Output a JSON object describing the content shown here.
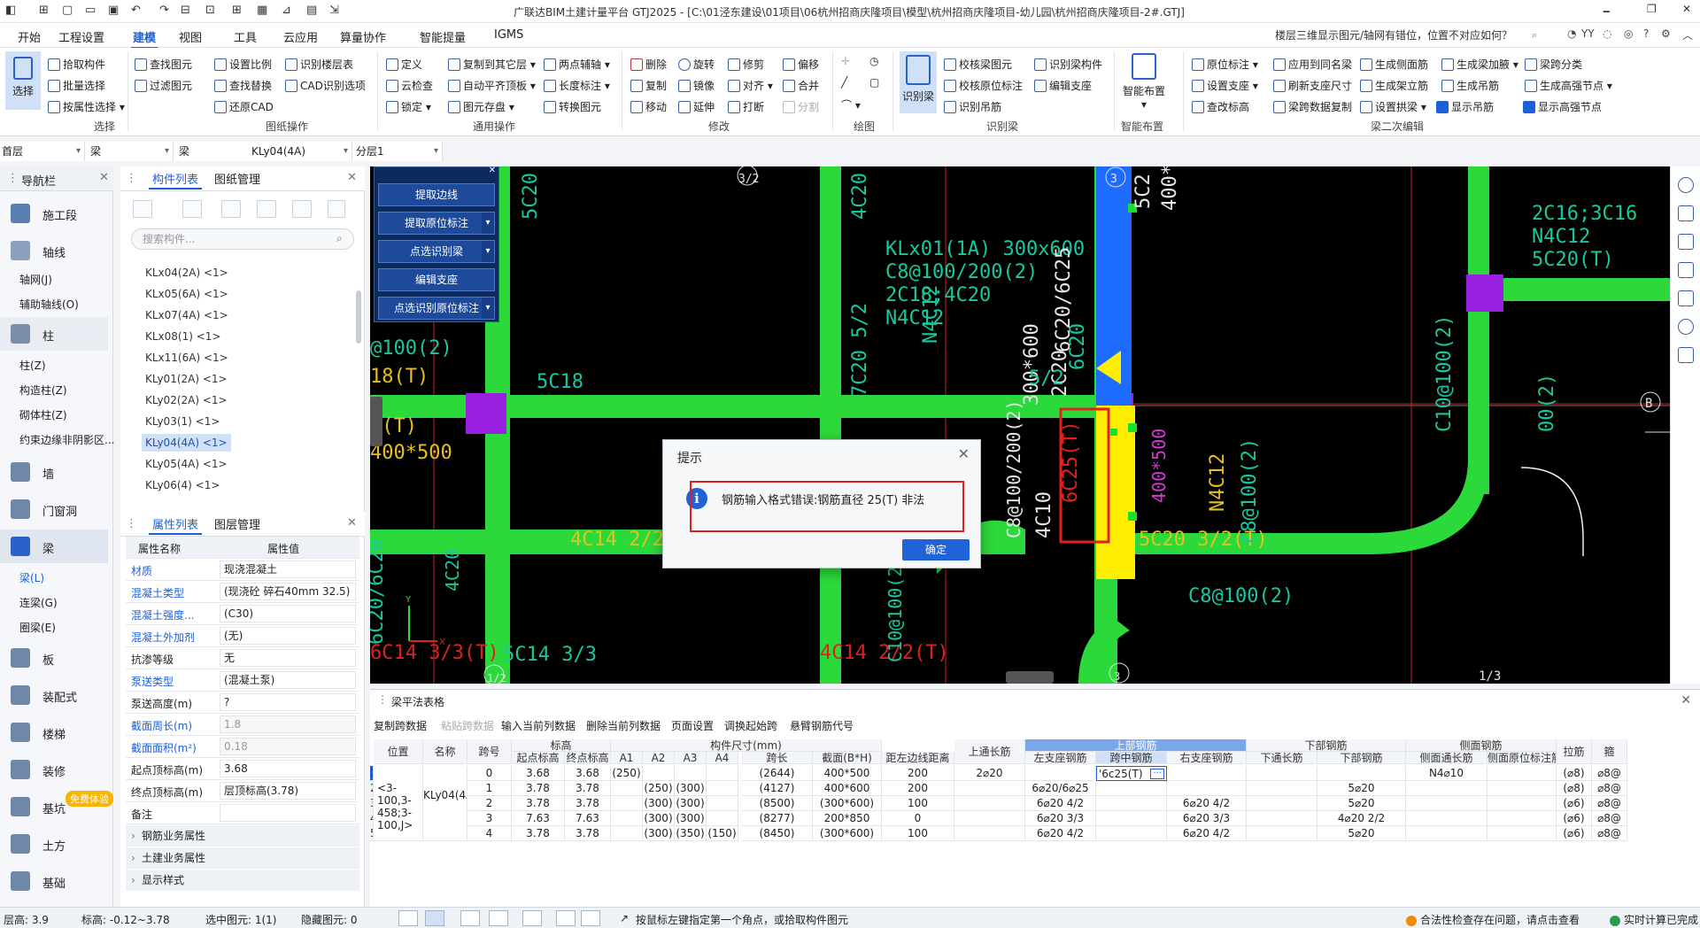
{
  "app": {
    "title": "广联达BIM土建计量平台 GTJ2025 - [C:\\01泾东建设\\01项目\\06杭州招商庆隆项目\\模型\\杭州招商庆隆项目-幼儿园\\杭州招商庆隆项目-2#.GTJ]",
    "window_controls": [
      "🗕",
      "❐",
      "✕"
    ]
  },
  "menu": {
    "items": [
      "开始",
      "工程设置",
      "建模",
      "视图",
      "工具",
      "云应用",
      "算量协作",
      "智能提量",
      "IGMS"
    ],
    "active": "建模",
    "hint": "楼层三维显示图元/轴网有错位，位置不对应如何？",
    "user": "YY"
  },
  "ribbon": {
    "select": {
      "big": "选择",
      "items": [
        "拾取构件",
        "批量选择",
        "按属性选择"
      ],
      "group": "选择"
    },
    "cad": {
      "items": [
        "查找图元",
        "过滤图元",
        "设置比例",
        "查找替换",
        "还原CAD",
        "识别楼层表",
        "CAD识别选项"
      ],
      "group": "图纸操作"
    },
    "common": {
      "items": [
        "定义",
        "云检查",
        "锁定",
        "复制到其它层",
        "自动平齐顶板",
        "图元存盘",
        "两点辅轴",
        "长度标注",
        "转换图元"
      ],
      "group": "通用操作"
    },
    "modify": {
      "items": [
        "删除",
        "复制",
        "移动",
        "旋转",
        "镜像",
        "延伸",
        "修剪",
        "对齐",
        "打断",
        "偏移",
        "合并",
        "分割"
      ],
      "group": "修改"
    },
    "draw": {
      "group": "绘图"
    },
    "recognize": {
      "big": "识别梁",
      "items": [
        "校核梁图元",
        "校核原位标注",
        "识别吊筋",
        "识别梁构件",
        "编辑支座"
      ],
      "group": "识别梁"
    },
    "smart": {
      "big": "智能布置",
      "group": "智能布置"
    },
    "beam2": {
      "items": [
        "原位标注",
        "设置支座",
        "查改标高",
        "应用到同名梁",
        "刷新支座尺寸",
        "梁跨数据复制",
        "生成侧面筋",
        "生成架立筋",
        "设置拱梁",
        "生成梁加腋",
        "生成吊筋",
        "显示吊筋",
        "梁跨分类",
        "生成高强节点",
        "显示高强节点"
      ],
      "group": "梁二次编辑"
    }
  },
  "selectors": [
    "首层",
    "梁",
    "梁",
    "KLy04(4A)",
    "分层1"
  ],
  "nav": {
    "title": "导航栏",
    "groups": [
      {
        "label": "施工段"
      },
      {
        "label": "轴线",
        "subs": [
          "轴网(J)",
          "辅助轴线(O)"
        ]
      },
      {
        "label": "柱",
        "subs": [
          "柱(Z)",
          "构造柱(Z)",
          "砌体柱(Z)",
          "约束边缘非阴影区..."
        ]
      },
      {
        "label": "墙"
      },
      {
        "label": "门窗洞"
      },
      {
        "label": "梁",
        "subs": [
          "梁(L)",
          "连梁(G)",
          "圈梁(E)"
        ]
      },
      {
        "label": "板"
      },
      {
        "label": "装配式"
      },
      {
        "label": "楼梯"
      },
      {
        "label": "装修"
      },
      {
        "label": "基坑"
      },
      {
        "label": "土方"
      },
      {
        "label": "基础"
      }
    ],
    "free_badge": "免费体验"
  },
  "components": {
    "tabs": [
      "构件列表",
      "图纸管理"
    ],
    "search_placeholder": "搜索构件...",
    "items": [
      "KLx04(2A) <1>",
      "KLx05(6A) <1>",
      "KLx07(4A) <1>",
      "KLx08(1) <1>",
      "KLx11(6A) <1>",
      "KLy01(2A) <1>",
      "KLy02(2A) <1>",
      "KLy03(1) <1>",
      "KLy04(4A) <1>",
      "KLy05(4A) <1>",
      "KLy06(4) <1>"
    ],
    "selected": "KLy04(4A) <1>"
  },
  "properties": {
    "tabs": [
      "属性列表",
      "图层管理"
    ],
    "headers": [
      "属性名称",
      "属性值"
    ],
    "rows": [
      {
        "name": "材质",
        "value": "现浇混凝土",
        "link": true
      },
      {
        "name": "混凝土类型",
        "value": "(现浇砼 碎石40mm 32.5)",
        "link": true
      },
      {
        "name": "混凝土强度...",
        "value": "(C30)",
        "link": true
      },
      {
        "name": "混凝土外加剂",
        "value": "(无)",
        "link": true
      },
      {
        "name": "抗渗等级",
        "value": "无",
        "link": false
      },
      {
        "name": "泵送类型",
        "value": "(混凝土泵)",
        "link": true
      },
      {
        "name": "泵送高度(m)",
        "value": "?",
        "link": false
      },
      {
        "name": "截面周长(m)",
        "value": "1.8",
        "link": true,
        "gray": true
      },
      {
        "name": "截面面积(m²)",
        "value": "0.18",
        "link": true,
        "gray": true
      },
      {
        "name": "起点顶标高(m)",
        "value": "3.68",
        "link": false
      },
      {
        "name": "终点顶标高(m)",
        "value": "层顶标高(3.78)",
        "link": false
      },
      {
        "name": "备注",
        "value": "",
        "link": false
      }
    ],
    "groups": [
      "钢筋业务属性",
      "土建业务属性",
      "显示样式"
    ]
  },
  "extract_panel": {
    "buttons": [
      "提取边线",
      "提取原位标注",
      "点选识别梁",
      "编辑支座",
      "点选识别原位标注"
    ]
  },
  "canvas_labels": {
    "grid_top": [
      "3/2",
      "3",
      "1/2",
      "3",
      "1/3",
      "B"
    ],
    "texts": [
      "5C20",
      "4C20",
      "5C2",
      "400*6",
      "KLx01(1A) 300x600",
      "C8@100/200(2)",
      "2C18;4C20",
      "N4C12",
      "6C20/6C25",
      "300*600",
      "2C20",
      "6C20",
      "@100(2)",
      "18(T)",
      "5C18",
      "7C20 5/2",
      "5/2",
      "4C14 2/2",
      "5C20 3/2(T)",
      "C8@100(2)",
      "C8@100/200(2)",
      "4C10",
      "N4C12",
      "6C25(T)",
      "400*500",
      "4C14 2/2(T)",
      "6C14 3/3(T)",
      "5C14 3/3",
      "C10@100(2)",
      "N4C12",
      "4C20",
      "C8@100(2)",
      "2C16;3C16",
      "N4C12",
      "5C20(T)",
      "C10@100(2)",
      "00(2)",
      "2(T)",
      "400*500",
      "6C20/6C20"
    ]
  },
  "dialog": {
    "title": "提示",
    "message": "钢筋输入格式错误:钢筋直径 25(T)   非法",
    "ok": "确定"
  },
  "table": {
    "title": "梁平法表格",
    "actions": [
      "复制跨数据",
      "粘贴跨数据",
      "输入当前列数据",
      "删除当前列数据",
      "页面设置",
      "调换起始跨",
      "悬臂钢筋代号"
    ],
    "disabled_action": "粘贴跨数据",
    "group_headers": [
      "标高",
      "构件尺寸(mm)",
      "上部钢筋",
      "下部钢筋",
      "侧面钢筋"
    ],
    "headers": [
      "位置",
      "名称",
      "跨号",
      "起点标高",
      "终点标高",
      "A1",
      "A2",
      "A3",
      "A4",
      "跨长",
      "截面(B*H)",
      "距左边线距离",
      "上通长筋",
      "左支座钢筋",
      "跨中钢筋",
      "右支座钢筋",
      "下通长筋",
      "下部钢筋",
      "侧面通长筋",
      "侧面原位标注筋",
      "拉筋",
      "箍"
    ],
    "position": "<3-100,3-458;3-100,J>",
    "name": "KLy04(4A)",
    "row_numbers": [
      "1",
      "2",
      "3",
      "4",
      "5"
    ],
    "rows": [
      [
        "0",
        "3.68",
        "3.68",
        "(250)",
        "",
        "",
        "",
        "(2644)",
        "400*500",
        "200",
        "2⌀20",
        "",
        "'6c25(T)",
        "",
        "",
        "",
        "N4⌀10",
        "",
        "(⌀8)",
        "⌀8@"
      ],
      [
        "1",
        "3.78",
        "3.78",
        "",
        "(250)",
        "(300)",
        "",
        "(4127)",
        "400*600",
        "200",
        "",
        "6⌀20/6⌀25",
        "",
        "",
        "",
        "5⌀20",
        "",
        "",
        "(⌀8)",
        "⌀8@"
      ],
      [
        "2",
        "3.78",
        "3.78",
        "",
        "(300)",
        "(300)",
        "",
        "(8500)",
        "(300*600)",
        "100",
        "",
        "6⌀20 4/2",
        "",
        "6⌀20 4/2",
        "",
        "5⌀20",
        "",
        "",
        "(⌀6)",
        "⌀8@"
      ],
      [
        "3",
        "7.63",
        "7.63",
        "",
        "(300)",
        "(300)",
        "",
        "(8277)",
        "200*850",
        "0",
        "",
        "6⌀20 3/3",
        "",
        "6⌀20 3/3",
        "",
        "4⌀20 2/2",
        "",
        "",
        "(⌀6)",
        "⌀8@"
      ],
      [
        "4",
        "3.78",
        "3.78",
        "",
        "(300)",
        "(350)",
        "(150)",
        "(8450)",
        "(300*600)",
        "100",
        "",
        "6⌀20 4/2",
        "",
        "6⌀20 4/2",
        "",
        "5⌀20",
        "",
        "",
        "(⌀6)",
        "⌀8@"
      ]
    ]
  },
  "status": {
    "floor_height": "层高:  3.9",
    "elevation": "标高:   -0.12~3.78",
    "selected": "选中图元: 1(1)",
    "hidden": "隐藏图元: 0",
    "tip": "按鼠标左键指定第一个角点，或拾取构件图元",
    "check": "合法性检查存在问题，请点击查看",
    "realtime": "实时计算已完成"
  },
  "colors": {
    "beam_green": "#2cd93a",
    "column_purple": "#9a20e0",
    "selected_yellow": "#ffee00",
    "selected_blue": "#1e6bff",
    "highlight_red": "#e02020",
    "accent": "#1e5fd9"
  }
}
